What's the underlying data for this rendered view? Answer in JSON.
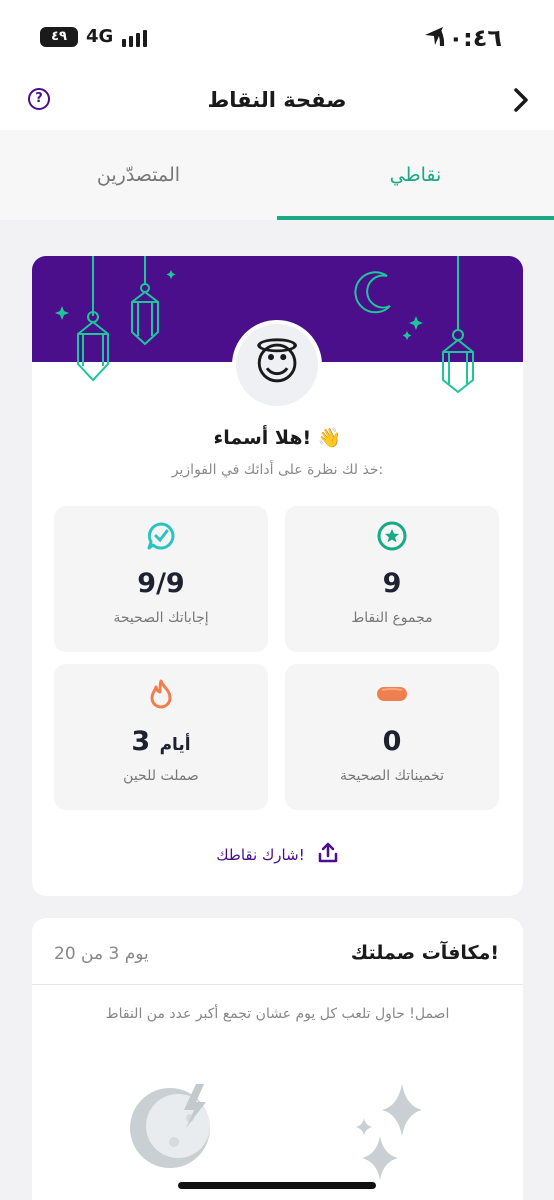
{
  "status_bar": {
    "time": "١٠:٤٦",
    "network": "4G",
    "battery": "٤٩"
  },
  "nav": {
    "title": "صفحة النقاط",
    "help_icon": "?"
  },
  "tabs": [
    {
      "label": "نقاطي",
      "active": true
    },
    {
      "label": "المتصدّرين",
      "active": false
    }
  ],
  "profile": {
    "avatar_emoji": "😇",
    "greeting": "هلا أسماء! 👋",
    "subtitle": "خذ لك نظرة على أدائك في الفوازير:"
  },
  "stats": {
    "total_points": {
      "value": "9",
      "label": "مجموع النقاط"
    },
    "correct_answers": {
      "value": "9/9",
      "label": "إجاباتك الصحيحة"
    },
    "correct_guesses": {
      "value": "0",
      "label": "تخميناتك الصحيحة"
    },
    "streak": {
      "value": "3",
      "unit": "أيام",
      "label": "صملت للحين"
    }
  },
  "share": {
    "label": "شارك نقاطك!"
  },
  "rewards": {
    "title": "مكافآت صملتك!",
    "day_progress": "يوم 3 من 20",
    "description": "اصمل! حاول تلعب كل يوم عشان تجمع أكبر عدد من النقاط"
  },
  "colors": {
    "brand_purple": "#4b0f8c",
    "accent_green": "#1aa985",
    "orange": "#f07f4f",
    "teal": "#2bc3c0"
  }
}
